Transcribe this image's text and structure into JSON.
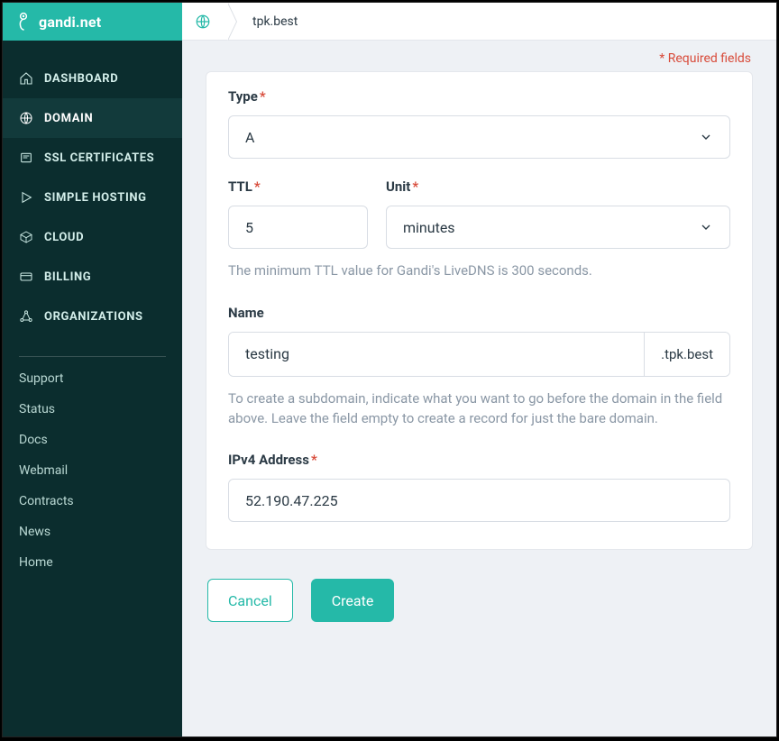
{
  "brand": {
    "name": "gandi.net"
  },
  "sidebar": {
    "items": [
      {
        "label": "DASHBOARD"
      },
      {
        "label": "DOMAIN"
      },
      {
        "label": "SSL CERTIFICATES"
      },
      {
        "label": "SIMPLE HOSTING"
      },
      {
        "label": "CLOUD"
      },
      {
        "label": "BILLING"
      },
      {
        "label": "ORGANIZATIONS"
      }
    ],
    "links": [
      "Support",
      "Status",
      "Docs",
      "Webmail",
      "Contracts",
      "News",
      "Home"
    ]
  },
  "breadcrumb": {
    "domain": "tpk.best"
  },
  "form": {
    "required_note": "* Required fields",
    "type_label": "Type",
    "type_value": "A",
    "ttl_label": "TTL",
    "ttl_value": "5",
    "unit_label": "Unit",
    "unit_value": "minutes",
    "ttl_help": "The minimum TTL value for Gandi's LiveDNS is 300 seconds.",
    "name_label": "Name",
    "name_value": "testing",
    "name_suffix": ".tpk.best",
    "name_help": "To create a subdomain, indicate what you want to go before the domain in the field above. Leave the field empty to create a record for just the bare domain.",
    "ipv4_label": "IPv4 Address",
    "ipv4_value": "52.190.47.225"
  },
  "actions": {
    "cancel": "Cancel",
    "create": "Create"
  }
}
